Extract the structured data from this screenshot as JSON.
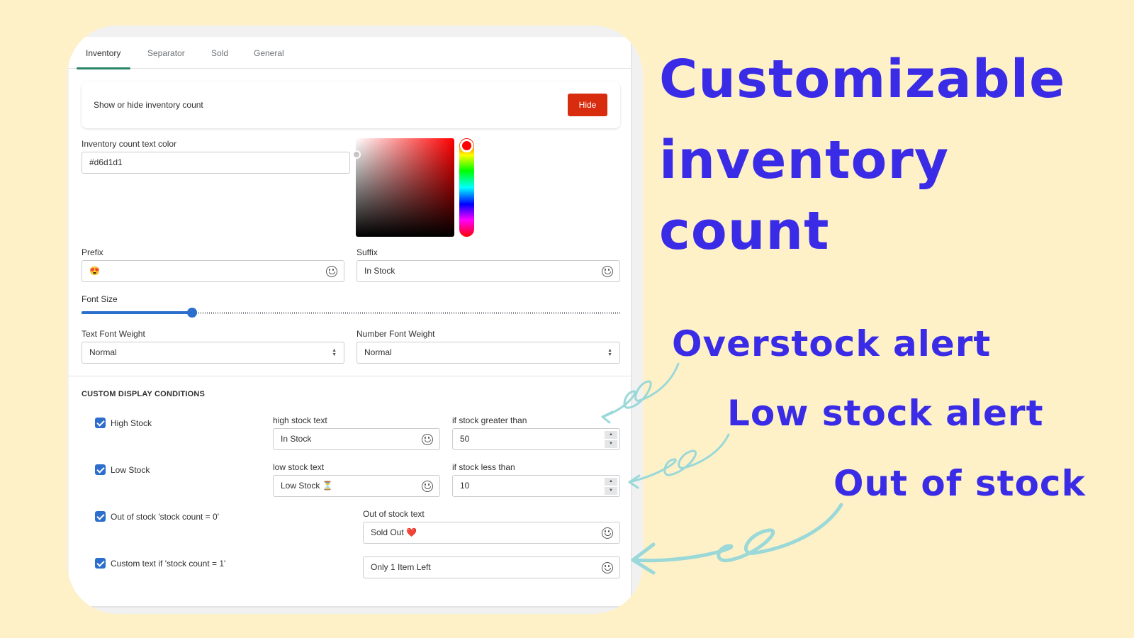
{
  "tabs": [
    {
      "label": "Inventory",
      "active": true
    },
    {
      "label": "Separator",
      "active": false
    },
    {
      "label": "Sold",
      "active": false
    },
    {
      "label": "General",
      "active": false
    }
  ],
  "visibility_card": {
    "label": "Show or hide inventory count",
    "button_label": "Hide",
    "button_color": "#d72c0d"
  },
  "text_color": {
    "label": "Inventory count text color",
    "value": "#d6d1d1",
    "hue": "red"
  },
  "prefix": {
    "label": "Prefix",
    "value": "😍"
  },
  "suffix": {
    "label": "Suffix",
    "value": "In Stock"
  },
  "font_size": {
    "label": "Font Size",
    "value_fraction": 0.205
  },
  "text_font_weight": {
    "label": "Text Font Weight",
    "value": "Normal"
  },
  "number_font_weight": {
    "label": "Number Font Weight",
    "value": "Normal"
  },
  "conditions": {
    "title": "CUSTOM DISPLAY CONDITIONS",
    "high_stock": {
      "checkbox_label": "High Stock",
      "checked": true,
      "text_label": "high stock text",
      "text_value": "In Stock",
      "threshold_label": "if stock greater than",
      "threshold_value": "50"
    },
    "low_stock": {
      "checkbox_label": "Low Stock",
      "checked": true,
      "text_label": "low stock text",
      "text_value": "Low Stock ⏳",
      "threshold_label": "if stock less than",
      "threshold_value": "10"
    },
    "out_of_stock": {
      "checkbox_label": "Out of stock 'stock count = 0'",
      "checked": true,
      "text_label": "Out of stock text",
      "text_value": "Sold Out ❤️"
    },
    "one_left": {
      "checkbox_label": "Custom text if 'stock count = 1'",
      "checked": true,
      "text_value": "Only 1 Item Left"
    }
  },
  "headline": {
    "line1": "Customizable",
    "line2": "inventory count"
  },
  "callouts": {
    "overstock": "Overstock alert",
    "low_stock": "Low stock alert",
    "out_of_stock": "Out of stock"
  },
  "colors": {
    "background": "#fef1c8",
    "headline": "#3a2ce6",
    "arrow": "#9bd8d8",
    "accent_blue": "#2c6ecb",
    "tab_indicator": "#2a8466"
  }
}
